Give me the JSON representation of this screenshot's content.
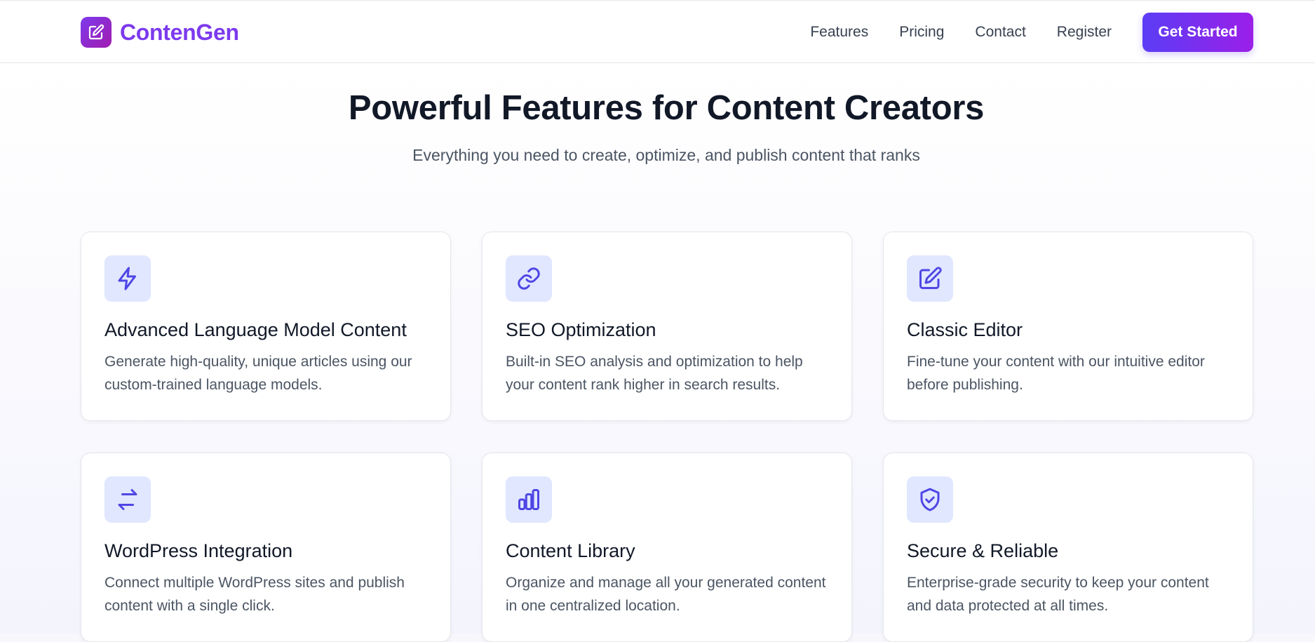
{
  "brand": {
    "name": "ContenGen",
    "icon": "edit-icon"
  },
  "nav": {
    "links": [
      "Features",
      "Pricing",
      "Contact",
      "Register"
    ],
    "cta_label": "Get Started"
  },
  "hero": {
    "title": "Powerful Features for Content Creators",
    "subtitle": "Everything you need to create, optimize, and publish content that ranks"
  },
  "features": [
    {
      "icon": "lightning-icon",
      "title": "Advanced Language Model Content",
      "description": "Generate high-quality, unique articles using our custom-trained language models."
    },
    {
      "icon": "link-icon",
      "title": "SEO Optimization",
      "description": "Built-in SEO analysis and optimization to help your content rank higher in search results."
    },
    {
      "icon": "edit-icon",
      "title": "Classic Editor",
      "description": "Fine-tune your content with our intuitive editor before publishing."
    },
    {
      "icon": "arrows-exchange-icon",
      "title": "WordPress Integration",
      "description": "Connect multiple WordPress sites and publish content with a single click."
    },
    {
      "icon": "bar-chart-icon",
      "title": "Content Library",
      "description": "Organize and manage all your generated content in one centralized location."
    },
    {
      "icon": "shield-check-icon",
      "title": "Secure & Reliable",
      "description": "Enterprise-grade security to keep your content and data protected at all times."
    }
  ],
  "colors": {
    "brand": "#7c3aed",
    "accent_start": "#5b3df5",
    "accent_end": "#9b1fe8",
    "icon_bg": "#e0e7ff",
    "icon_stroke": "#4f46e5"
  }
}
